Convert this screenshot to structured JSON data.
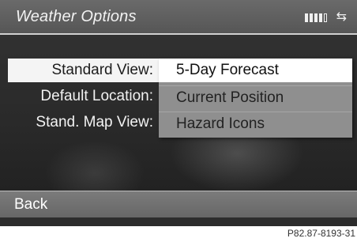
{
  "header": {
    "title": "Weather Options",
    "signal_icon": "signal-strength-icon",
    "connection_icon": "left-right-arrows-icon"
  },
  "settings": [
    {
      "label": "Standard View:"
    },
    {
      "label": "Default Location:"
    },
    {
      "label": "Stand. Map View:"
    }
  ],
  "dropdown": {
    "options": [
      "5-Day Forecast",
      "Current Position",
      "Hazard Icons"
    ],
    "selected_index": 0
  },
  "footer": {
    "back_label": "Back"
  },
  "reference_code": "P82.87-8193-31",
  "colors": {
    "title_bar": "#5e5e5e",
    "selection": "#ffffff",
    "dropdown_bg": "#8f8f8f",
    "screen_bg": "#2c2c2c"
  }
}
